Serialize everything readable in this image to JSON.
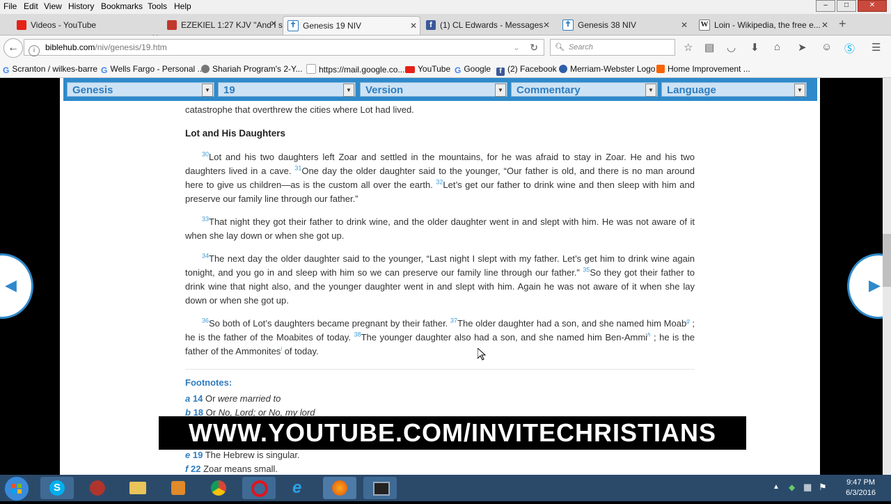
{
  "menu": [
    "File",
    "Edit",
    "View",
    "History",
    "Bookmarks",
    "Tools",
    "Help"
  ],
  "window_controls": {
    "minimize": "–",
    "maximize": "□",
    "close": "✕"
  },
  "tabs": [
    {
      "title": "Videos - YouTube",
      "icon": "youtube-icon",
      "color": "#e62117"
    },
    {
      "title": "EZEKIEL 1:27 KJV \"And I sa...",
      "icon": "bible-icon",
      "color": "#c0392b"
    },
    {
      "title": "Genesis 19 NIV",
      "icon": "cross-icon",
      "color": "#2e7cbf",
      "active": true
    },
    {
      "title": "(1) CL Edwards - Messages",
      "icon": "facebook-icon",
      "color": "#3b5998"
    },
    {
      "title": "Genesis 38 NIV",
      "icon": "cross-icon",
      "color": "#2e7cbf"
    },
    {
      "title": "Loin - Wikipedia, the free e...",
      "icon": "wikipedia-icon",
      "color": "#555555"
    }
  ],
  "new_tab": "+",
  "nav": {
    "back": "←",
    "url_domain": "biblehub.com",
    "url_path": "/niv/genesis/19.htm",
    "search_placeholder": "Search"
  },
  "bookmarks": [
    {
      "label": "Scranton / wilkes-barre",
      "icon": "google-icon",
      "color": "#4285f4"
    },
    {
      "label": "Wells Fargo - Personal ...",
      "icon": "google-icon",
      "color": "#4285f4"
    },
    {
      "label": "Shariah Program's 2-Y...",
      "icon": "globe-icon",
      "color": "#666666"
    },
    {
      "label": "https://mail.google.co...",
      "icon": "page-icon",
      "color": "#999999"
    },
    {
      "label": "YouTube",
      "icon": "youtube-icon",
      "color": "#e62117"
    },
    {
      "label": "Google",
      "icon": "google-icon",
      "color": "#4285f4"
    },
    {
      "label": "(2) Facebook",
      "icon": "facebook-icon",
      "color": "#3b5998"
    },
    {
      "label": "Merriam-Webster Logo",
      "icon": "mw-icon",
      "color": "#2d5ea8"
    },
    {
      "label": "Home Improvement ...",
      "icon": "homedepot-icon",
      "color": "#f96302"
    }
  ],
  "selectors": [
    "Genesis",
    "19",
    "Version",
    "Commentary",
    "Language"
  ],
  "content": {
    "intro_line": "catastrophe that overthrew the cities where Lot had lived.",
    "heading": "Lot and His Daughters",
    "p1": {
      "v30": "30",
      "t30": "Lot and his two daughters left Zoar and settled in the mountains, for he was afraid to stay in Zoar. He and his two daughters lived in a cave.",
      "v31": "31",
      "t31": "One day the older daughter said to the younger, “Our father is old, and there is no man around here to give us children—as is the custom all over the earth.",
      "v32": "32",
      "t32": "Let’s get our father to drink wine and then sleep with him and preserve our family line through our father.”"
    },
    "p2": {
      "v33": "33",
      "t33": "That night they got their father to drink wine, and the older daughter went in and slept with him. He was not aware of it when she lay down or when she got up."
    },
    "p3": {
      "v34": "34",
      "t34": "The next day the older daughter said to the younger, “Last night I slept with my father. Let’s get him to drink wine again tonight, and you go in and sleep with him so we can preserve our family line through our father.”",
      "v35": "35",
      "t35": "So they got their father to drink wine that night also, and the younger daughter went in and slept with him. Again he was not aware of it when she lay down or when she got up."
    },
    "p4": {
      "v36": "36",
      "t36": "So both of Lot’s daughters became pregnant by their father.",
      "v37": "37",
      "t37a": "The older daughter had a son, and she named him Moab",
      "fn_g": "g",
      "t37b": " ; he is the father of the Moabites of today.",
      "v38": "38",
      "t38a": "The younger daughter also had a son, and she named him Ben-Ammi",
      "fn_h": "h",
      "t38b": " ; he is the father of the Ammonites",
      "fn_i": "i",
      "t38c": " of today."
    }
  },
  "footnotes": {
    "title": "Footnotes:",
    "items": [
      {
        "letter": "a",
        "ref": "14",
        "pre": "Or ",
        "text": "were married to",
        "italic": true
      },
      {
        "letter": "b",
        "ref": "18",
        "pre": "Or ",
        "text": "No, Lord; or No, my lord",
        "italic": true
      },
      {
        "letter": "e",
        "ref": "19",
        "pre": "",
        "text": "The Hebrew is singular.",
        "italic": false
      },
      {
        "letter": "f",
        "ref": "22",
        "pre": "",
        "text": "Zoar means small.",
        "italic": false
      }
    ]
  },
  "banner": "WWW.YOUTUBE.COM/INVITECHRISTIANS",
  "clock": {
    "time": "9:47 PM",
    "date": "6/3/2016"
  },
  "colors": {
    "accent": "#2e8acb",
    "verse_number": "#3e9bd6",
    "footnote": "#2e7cbf"
  }
}
